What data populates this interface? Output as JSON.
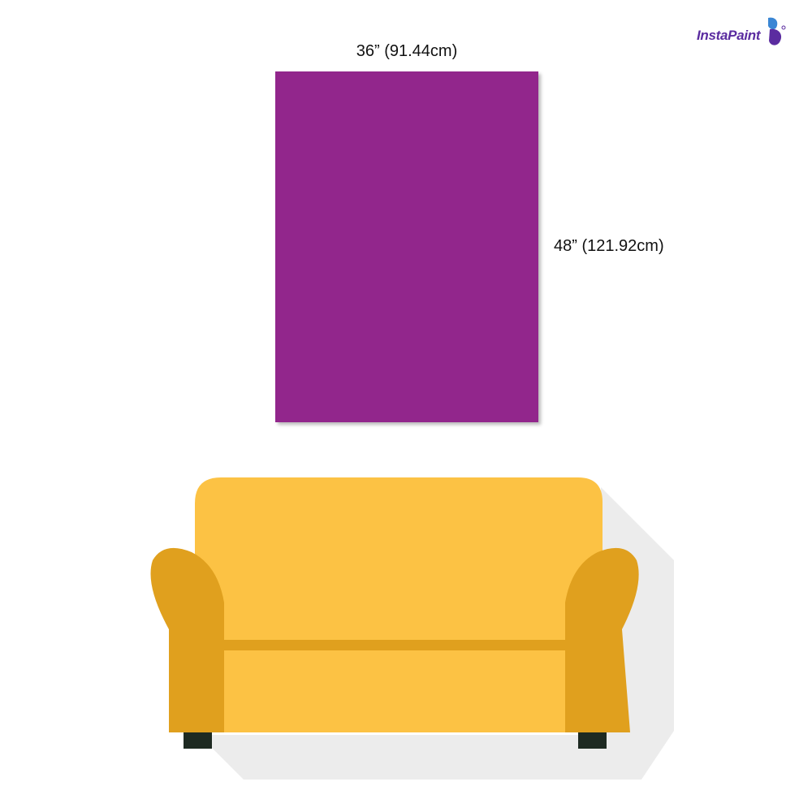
{
  "brand": {
    "name": "InstaPaint",
    "logo_icon": "butterfly-icon",
    "color": "#5b2ca0",
    "accent": "#3a86d4"
  },
  "canvas": {
    "width_label": "36” (91.44cm)",
    "height_label": "48” (121.92cm)",
    "color": "#92268c"
  },
  "sofa": {
    "color_body": "#fcc244",
    "color_arms": "#e0a01e",
    "color_legs": "#1e2a22"
  }
}
